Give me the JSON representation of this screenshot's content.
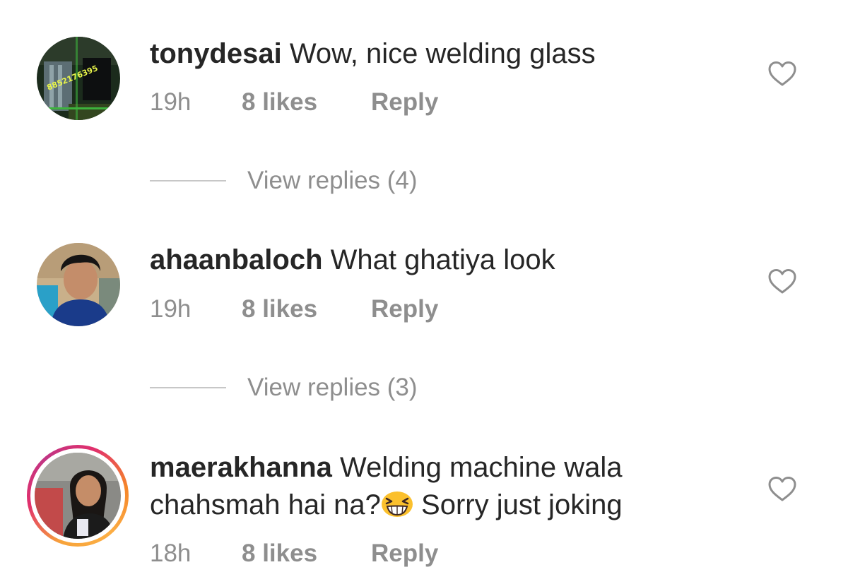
{
  "comments": [
    {
      "username": "tonydesai",
      "text": "Wow, nice welding glass",
      "time": "19h",
      "likes": "8 likes",
      "reply": "Reply",
      "view_replies": "View replies (4)",
      "avatar_text": "8852176395",
      "has_story_ring": false
    },
    {
      "username": "ahaanbaloch",
      "text": "What ghatiya look",
      "time": "19h",
      "likes": "8 likes",
      "reply": "Reply",
      "view_replies": "View replies (3)",
      "has_story_ring": false
    },
    {
      "username": "maerakhanna",
      "text_before_emoji": "Welding machine wala chahsmah hai na?",
      "emoji": "grinning-squinting-face-emoji",
      "text_after_emoji": " Sorry just joking",
      "time": "18h",
      "likes": "8 likes",
      "reply": "Reply",
      "has_story_ring": true
    }
  ],
  "colors": {
    "text": "#262626",
    "secondary": "#8e8e8e",
    "divider": "#c7c7c7",
    "story_ring": [
      "#fcaf45",
      "#e1306c",
      "#c13584"
    ]
  },
  "icons": {
    "like": "heart-outline-icon"
  }
}
